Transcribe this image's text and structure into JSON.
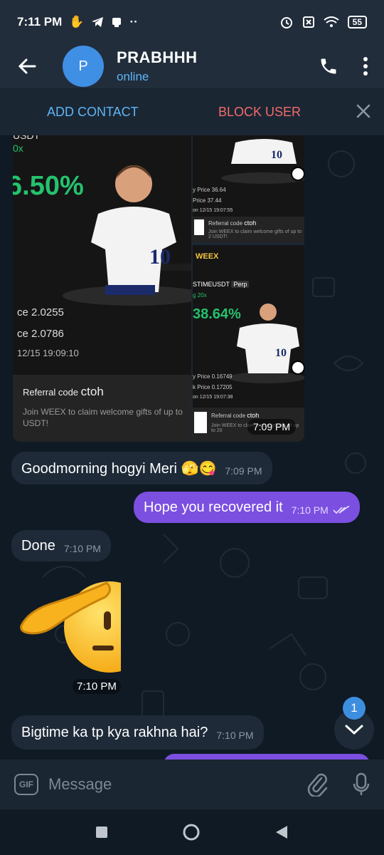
{
  "status_bar": {
    "time": "7:11 PM",
    "battery": "55"
  },
  "header": {
    "avatar_letter": "P",
    "name": "PRABHHH",
    "status": "online"
  },
  "action_bar": {
    "add_contact": "ADD CONTACT",
    "block_user": "BLOCK USER"
  },
  "album": {
    "big_card": {
      "symbol": "USDT",
      "leverage": "0x",
      "percent": "6.50%",
      "entry_price": "ce  2.0255",
      "last_price": "ce  2.0786",
      "date": "12/15 19:09:10",
      "referral_label": "Referral code",
      "referral_code": "ctoh",
      "referral_text": "Join WEEX to claim welcome gifts of up to USDT!"
    },
    "small_top": {
      "price1": "y Price  36.64",
      "price2": "Price  37.44",
      "date": "on 12/15 19:07:55",
      "referral_label": "Referral code",
      "referral_code": "ctoh",
      "referral_text": "Join WEEX to claim welcome gifts of up to 2 USDT!"
    },
    "small_bottom": {
      "logo": "WEEX",
      "symbol": "STIMEUSDT",
      "perp": "Perp",
      "leverage": "g  20x",
      "percent": "38.64%",
      "price1": "y Price  0.16749",
      "price2": "k Price  0.17205",
      "date": "on 12/15 19:07:38",
      "referral_label": "Referral code",
      "referral_code": "ctoh",
      "referral_text": "Join WEEX to claim welcome gifts of up to 20"
    },
    "time": "7:09 PM"
  },
  "messages": [
    {
      "text": "Goodmorning hogyi Meri 🫣😋",
      "time": "7:09 PM"
    },
    {
      "text": "Hope you recovered it",
      "time": "7:10 PM"
    },
    {
      "text": "Done",
      "time": "7:10 PM"
    },
    {
      "text": "Bigtime ka tp kya rakhna hai?",
      "time": "7:10 PM"
    }
  ],
  "sticker": {
    "time": "7:10 PM",
    "emoji": "saluting-face"
  },
  "scroll": {
    "unread": "1"
  },
  "input": {
    "placeholder": "Message",
    "gif_label": "GIF"
  },
  "colors": {
    "header_bg": "#212d3b",
    "incoming_bubble": "#1e2a38",
    "outgoing_bubble": "#7b4fe0",
    "accent_blue": "#5eb5f7",
    "danger_red": "#f36b6b"
  }
}
